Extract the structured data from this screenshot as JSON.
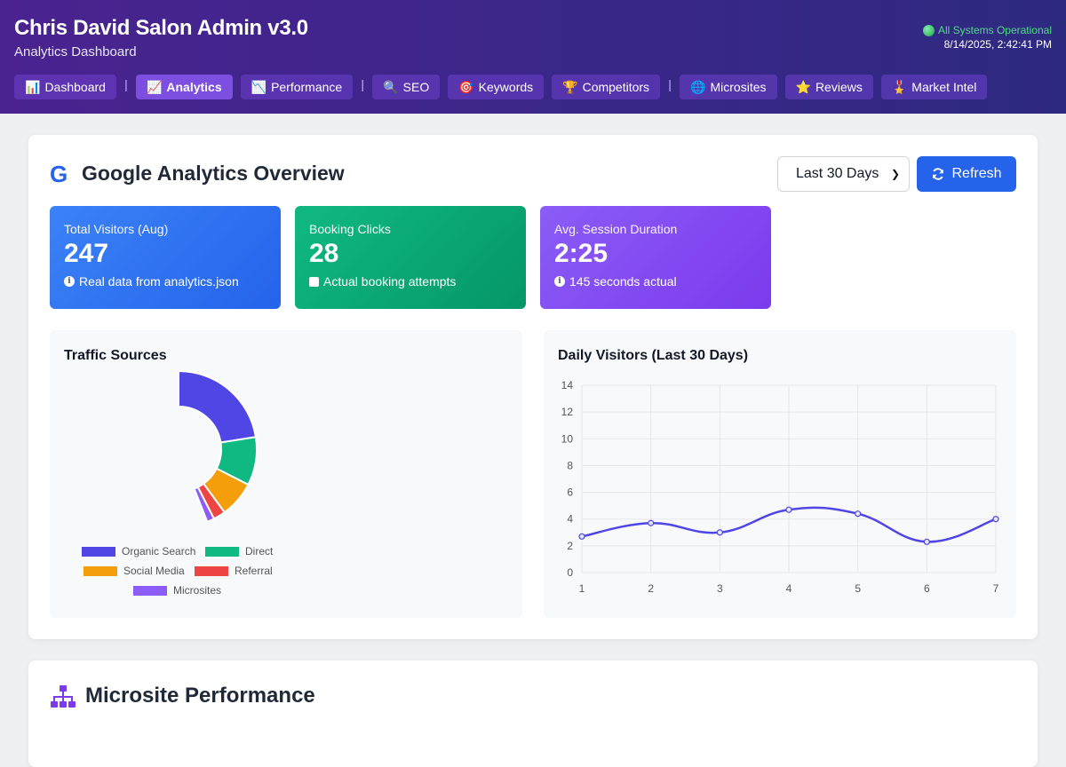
{
  "header": {
    "title": "Chris David Salon Admin v3.0",
    "subtitle": "Analytics Dashboard",
    "status": "All Systems Operational",
    "timestamp": "8/14/2025, 2:42:41 PM",
    "status_color": "#4ade80"
  },
  "nav": {
    "items": [
      {
        "icon": "📊",
        "label": "Dashboard"
      },
      {
        "icon": "📈",
        "label": "Analytics",
        "active": true
      },
      {
        "icon": "📉",
        "label": "Performance"
      },
      {
        "icon": "🔍",
        "label": "SEO"
      },
      {
        "icon": "🎯",
        "label": "Keywords"
      },
      {
        "icon": "🏆",
        "label": "Competitors"
      },
      {
        "icon": "🌐",
        "label": "Microsites"
      },
      {
        "icon": "⭐",
        "label": "Reviews"
      },
      {
        "icon": "🎖️",
        "label": "Market Intel"
      }
    ],
    "separator": "|"
  },
  "overview": {
    "title": "Google Analytics Overview",
    "logo_letter": "G",
    "range": "Last 30 Days",
    "refresh_label": "Refresh"
  },
  "stats": [
    {
      "label": "Total Visitors (Aug)",
      "value": "247",
      "note": "Real data from analytics.json",
      "color": "#2563eb"
    },
    {
      "label": "Booking Clicks",
      "value": "28",
      "note": "Actual booking attempts",
      "color": "#059669"
    },
    {
      "label": "Avg. Session Duration",
      "value": "2:25",
      "note": "145 seconds actual",
      "color": "#7c3aed"
    }
  ],
  "traffic_panel": {
    "title": "Traffic Sources"
  },
  "visitors_panel": {
    "title": "Daily Visitors (Last 30 Days)"
  },
  "chart_data": [
    {
      "type": "pie",
      "title": "Traffic Sources",
      "categories": [
        "Organic Search",
        "Direct",
        "Social Media",
        "Referral",
        "Microsites"
      ],
      "values": [
        45,
        20,
        15,
        5,
        3
      ],
      "colors": [
        "#4f46e5",
        "#10b981",
        "#f59e0b",
        "#ef4444",
        "#8b5cf6"
      ],
      "legend": "bottom"
    },
    {
      "type": "line",
      "title": "Daily Visitors (Last 30 Days)",
      "x": [
        1,
        2,
        3,
        4,
        5,
        6,
        7
      ],
      "series": [
        {
          "values": [
            2.7,
            3.7,
            3.0,
            4.7,
            4.4,
            2.3,
            4.0
          ],
          "color": "#4f46e5"
        }
      ],
      "ylim": [
        0,
        14
      ],
      "yticks": [
        0,
        2,
        4,
        6,
        8,
        10,
        12,
        14
      ],
      "grid": true
    }
  ],
  "microsite": {
    "title": "Microsite Performance"
  }
}
